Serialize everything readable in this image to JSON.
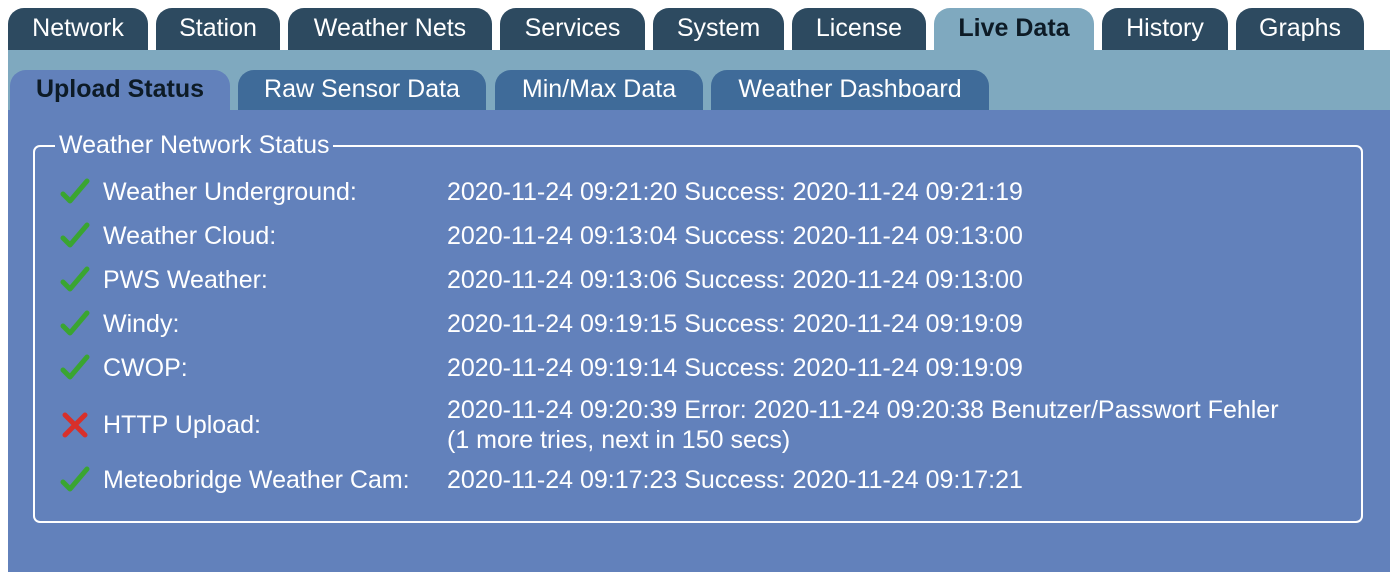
{
  "top_tabs": [
    {
      "label": "Network",
      "active": false
    },
    {
      "label": "Station",
      "active": false
    },
    {
      "label": "Weather Nets",
      "active": false
    },
    {
      "label": "Services",
      "active": false
    },
    {
      "label": "System",
      "active": false
    },
    {
      "label": "License",
      "active": false
    },
    {
      "label": "Live Data",
      "active": true
    },
    {
      "label": "History",
      "active": false
    },
    {
      "label": "Graphs",
      "active": false
    }
  ],
  "sub_tabs": [
    {
      "label": "Upload Status",
      "active": true
    },
    {
      "label": "Raw Sensor Data",
      "active": false
    },
    {
      "label": "Min/Max Data",
      "active": false
    },
    {
      "label": "Weather Dashboard",
      "active": false
    }
  ],
  "panel": {
    "legend": "Weather Network Status",
    "rows": [
      {
        "icon": "checkmark-icon",
        "label": "Weather Underground:",
        "status": "2020-11-24 09:21:20 Success: 2020-11-24 09:21:19"
      },
      {
        "icon": "checkmark-icon",
        "label": "Weather Cloud:",
        "status": "2020-11-24 09:13:04 Success: 2020-11-24 09:13:00"
      },
      {
        "icon": "checkmark-icon",
        "label": "PWS Weather:",
        "status": "2020-11-24 09:13:06 Success: 2020-11-24 09:13:00"
      },
      {
        "icon": "checkmark-icon",
        "label": "Windy:",
        "status": "2020-11-24 09:19:15 Success: 2020-11-24 09:19:09"
      },
      {
        "icon": "checkmark-icon",
        "label": "CWOP:",
        "status": "2020-11-24 09:19:14 Success: 2020-11-24 09:19:09"
      },
      {
        "icon": "error-x-icon",
        "label": "HTTP Upload:",
        "status": "2020-11-24 09:20:39 Error: 2020-11-24 09:20:38 Benutzer/Passwort Fehler",
        "status_line2": "(1 more tries, next in 150 secs)"
      },
      {
        "icon": "checkmark-icon",
        "label": "Meteobridge Weather Cam:",
        "status": "2020-11-24 09:17:23 Success: 2020-11-24 09:17:21"
      }
    ]
  },
  "colors": {
    "tab_dark": "#2d4a60",
    "tab_light": "#7fa9bf",
    "content_bg": "#6281bb",
    "sub_tab": "#3f6b99",
    "success_green": "#3aa531",
    "error_red": "#d8302a"
  }
}
